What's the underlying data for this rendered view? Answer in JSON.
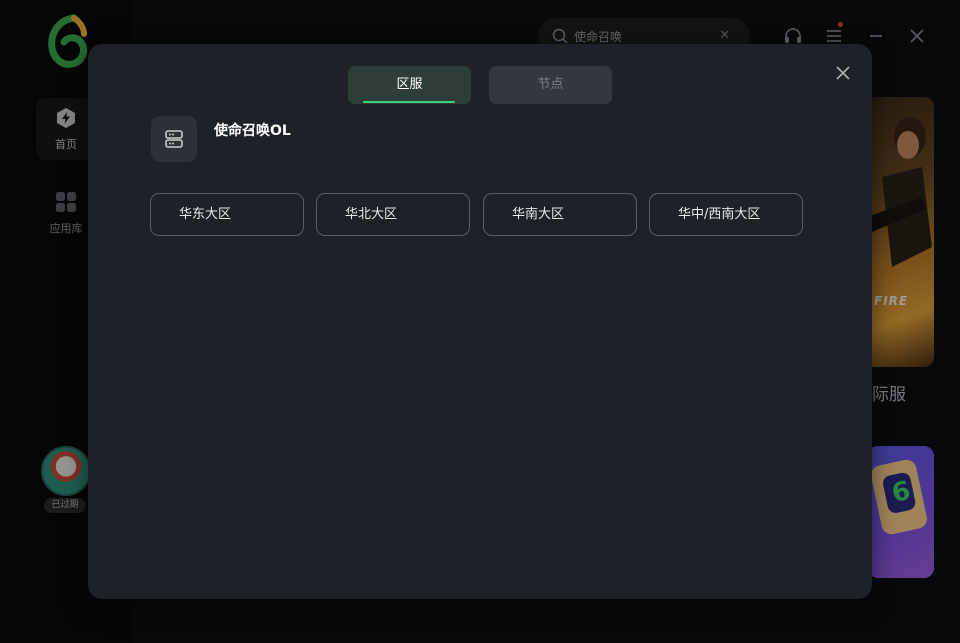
{
  "sidebar": {
    "items": [
      {
        "label": "首页",
        "icon": "lightning-home-icon",
        "active": true
      },
      {
        "label": "应用库",
        "icon": "app-grid-icon",
        "active": false
      }
    ],
    "user_badge": "已过期"
  },
  "header": {
    "search": {
      "value": "使命召唤",
      "icon": "search-icon"
    }
  },
  "background_cards": {
    "card1_logo_text": "FIRE",
    "card1_label": "际服"
  },
  "modal": {
    "tabs": [
      {
        "label": "区服",
        "active": true
      },
      {
        "label": "节点",
        "active": false
      }
    ],
    "game": {
      "title": "使命召唤OL",
      "icon": "server-stack-icon"
    },
    "regions": [
      "华东大区",
      "华北大区",
      "华南大区",
      "华中/西南大区"
    ]
  },
  "colors": {
    "accent": "#3fd07e",
    "modal_bg": "#1e2228",
    "active_tab_bg": "#2c3d3a",
    "inactive_tab_bg": "#34373d"
  }
}
